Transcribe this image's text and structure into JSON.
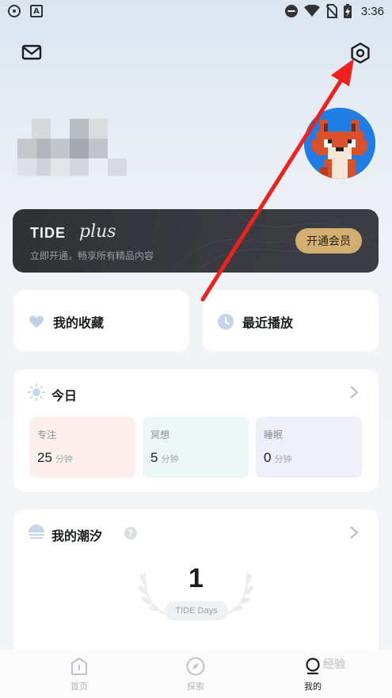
{
  "status_bar": {
    "time": "3:36",
    "left_icons": [
      "record-icon",
      "a-icon"
    ],
    "right_icons": [
      "dnd-icon",
      "wifi-icon",
      "no-sim-icon",
      "battery-charging-icon"
    ],
    "a_glyph": "A"
  },
  "header": {
    "mail_icon": "mail-icon",
    "settings_icon": "settings-icon"
  },
  "profile": {
    "username_pixelated": true,
    "avatar_icon": "fox-avatar",
    "avatar_bg": "#1e7ee6"
  },
  "membership": {
    "brand": "TIDE",
    "brand_script": "plus",
    "subtitle": "立即开通，畅享所有精品内容",
    "cta_label": "开通会员",
    "cta_color": "#d2ae71"
  },
  "quick_cards": [
    {
      "label": "我的收藏",
      "icon": "heart-icon"
    },
    {
      "label": "最近播放",
      "icon": "clock-icon"
    }
  ],
  "today": {
    "title": "今日",
    "icon": "sun-icon",
    "stats": [
      {
        "label": "专注",
        "value": "25",
        "unit": "分钟",
        "bg": "#fdf0ec"
      },
      {
        "label": "冥想",
        "value": "5",
        "unit": "分钟",
        "bg": "#eef7f8"
      },
      {
        "label": "睡眠",
        "value": "0",
        "unit": "分钟",
        "bg": "#eeeff9"
      }
    ]
  },
  "my_tide": {
    "title": "我的潮汐",
    "help": "?",
    "icon": "tide-icon",
    "days_count": "1",
    "days_label": "TIDE Days"
  },
  "tab_bar": {
    "tabs": [
      {
        "label": "首页",
        "icon": "home-icon",
        "active": false
      },
      {
        "label": "探索",
        "icon": "compass-icon",
        "active": false
      },
      {
        "label": "我的",
        "icon": "profile-icon",
        "active": true
      }
    ]
  },
  "watermark": "经验",
  "annotation": {
    "arrow_color": "#f0201c"
  }
}
